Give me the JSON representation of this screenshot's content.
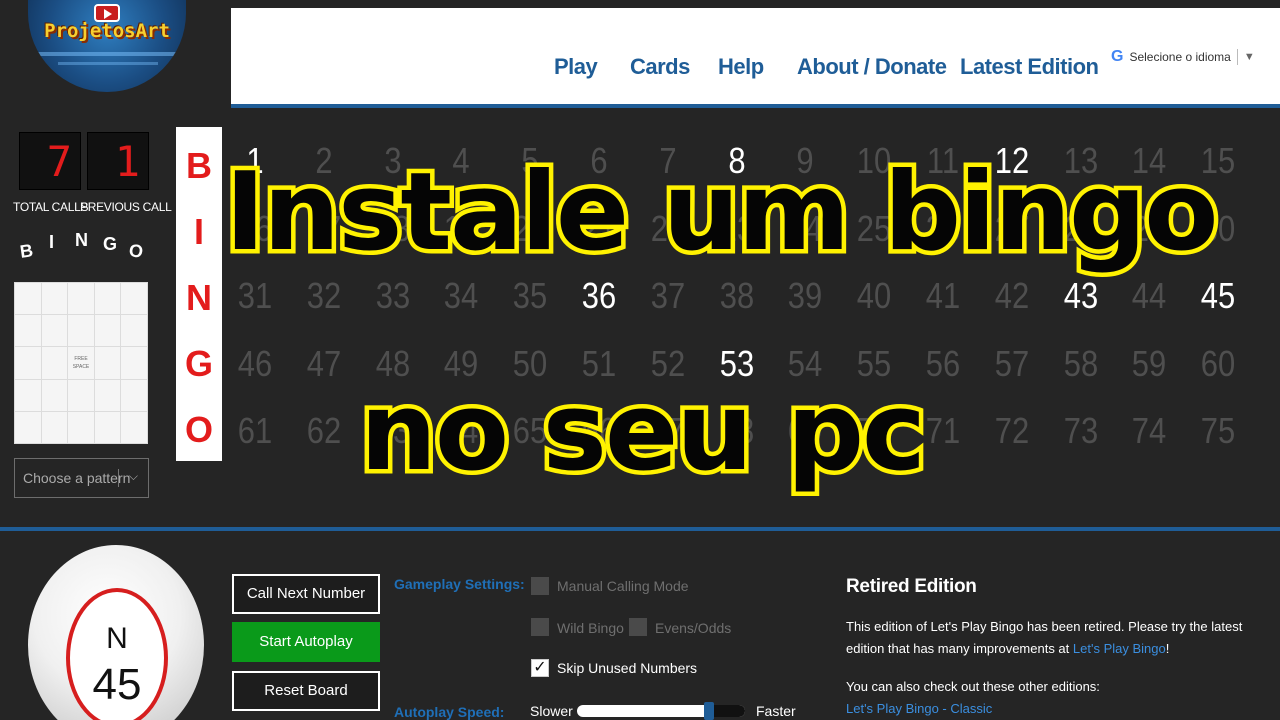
{
  "header": {
    "logo_text": "ProjetosArt",
    "nav": [
      "Play",
      "Cards",
      "Help",
      "About / Donate",
      "Latest Edition"
    ],
    "language_label": "Selecione o idioma"
  },
  "counters": {
    "total_calls": "7",
    "previous_call": "1",
    "total_calls_label": "TOTAL CALLS",
    "previous_call_label": "PREVIOUS CALL"
  },
  "card": {
    "letters": [
      "B",
      "I",
      "N",
      "G",
      "O"
    ],
    "free_space": "FREE SPACE",
    "pattern_placeholder": "Choose a pattern"
  },
  "bingo_column": [
    "B",
    "I",
    "N",
    "G",
    "O"
  ],
  "board": {
    "called": [
      1,
      8,
      12,
      36,
      43,
      53,
      45
    ]
  },
  "overlay": {
    "line1": "Instale um bingo",
    "line2": "no seu pc"
  },
  "current_ball": {
    "letter": "N",
    "number": "45"
  },
  "controls": {
    "call_next": "Call Next Number",
    "start_autoplay": "Start Autoplay",
    "reset_board": "Reset Board"
  },
  "settings": {
    "gameplay_label": "Gameplay Settings:",
    "autoplay_label": "Autoplay Speed:",
    "manual_calling": "Manual Calling Mode",
    "wild_bingo": "Wild Bingo",
    "evens_odds": "Evens/Odds",
    "skip_unused": "Skip Unused Numbers",
    "skip_unused_checked": true,
    "slower": "Slower",
    "faster": "Faster",
    "speed_level": 0.78
  },
  "retired": {
    "title": "Retired Edition",
    "text": "This edition of Let's Play Bingo has been retired. Please try the latest edition that has many improvements at",
    "link1": "Let's Play Bingo",
    "after_link": "!",
    "text2": "You can also check out these other editions:",
    "link2": "Let's Play Bingo - Classic"
  },
  "colors": {
    "accent_blue": "#1f5d97",
    "bingo_red": "#e31c1c",
    "overlay_yellow": "#fff200",
    "autoplay_green": "#0a9a1a"
  }
}
